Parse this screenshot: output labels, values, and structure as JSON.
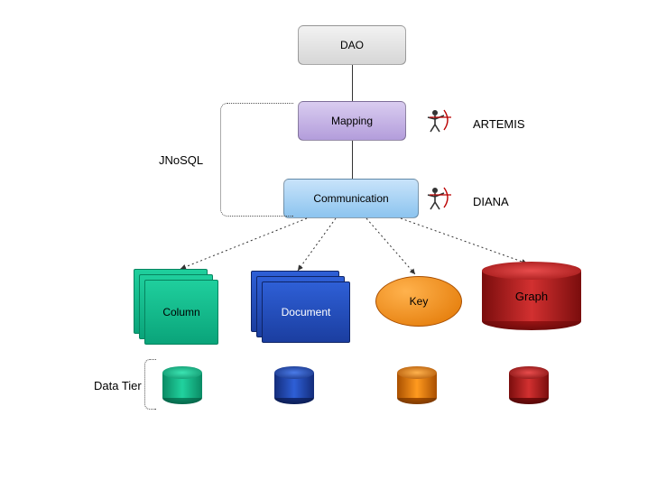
{
  "nodes": {
    "dao": "DAO",
    "mapping": "Mapping",
    "communication": "Communication",
    "column": "Column",
    "document": "Document",
    "key": "Key",
    "graph": "Graph"
  },
  "labels": {
    "jnosql": "JNoSQL",
    "artemis": "ARTEMIS",
    "diana": "DIANA",
    "data_tier": "Data Tier"
  }
}
